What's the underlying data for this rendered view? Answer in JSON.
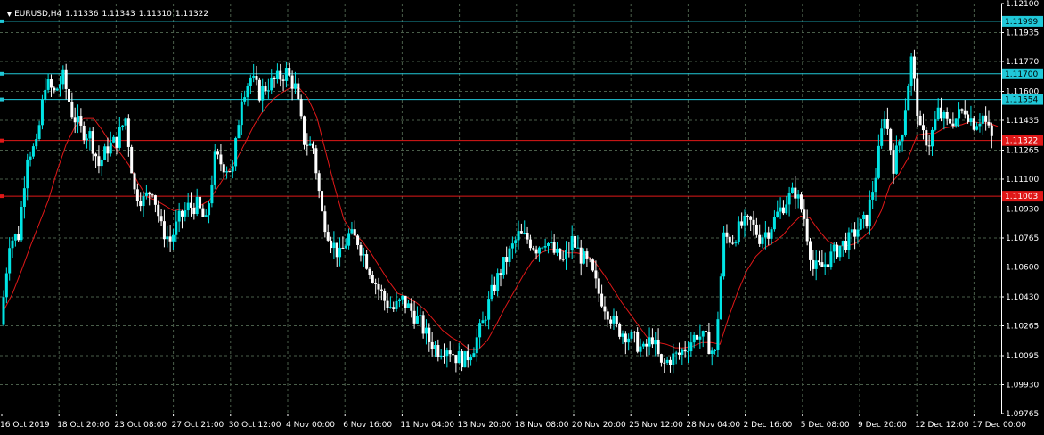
{
  "header": {
    "symbol": "EURUSD,H4",
    "open": "1.11336",
    "high": "1.11343",
    "low": "1.11310",
    "close": "1.11322"
  },
  "colors": {
    "background": "#000000",
    "grid": "#4a5e4a",
    "axis": "#ffffff",
    "bull_candle": "#00e5e5",
    "bear_candle": "#ffffff",
    "ma_line": "#e01818",
    "level_cyan": "#20c8d8",
    "level_red": "#e01818"
  },
  "chart_data": {
    "type": "candlestick",
    "title": "EURUSD,H4",
    "xlabel": "",
    "ylabel": "",
    "ylim": [
      1.09765,
      1.121
    ],
    "grid": true,
    "y_ticks": [
      "1.12100",
      "1.11935",
      "1.11770",
      "1.11600",
      "1.11435",
      "1.11265",
      "1.11100",
      "1.10930",
      "1.10765",
      "1.10600",
      "1.10430",
      "1.10265",
      "1.10095",
      "1.09930",
      "1.09765"
    ],
    "x_ticks": [
      "16 Oct 2019",
      "18 Oct 20:00",
      "23 Oct 08:00",
      "27 Oct 21:00",
      "30 Oct 12:00",
      "4 Nov 00:00",
      "6 Nov 16:00",
      "11 Nov 04:00",
      "13 Nov 20:00",
      "18 Nov 08:00",
      "20 Nov 20:00",
      "25 Nov 12:00",
      "28 Nov 04:00",
      "2 Dec 16:00",
      "5 Dec 08:00",
      "9 Dec 20:00",
      "12 Dec 12:00",
      "17 Dec 00:00"
    ],
    "close_series": [
      1.1027,
      1.1075,
      1.1078,
      1.1125,
      1.1128,
      1.1165,
      1.1159,
      1.1168,
      1.1148,
      1.1138,
      1.1135,
      1.1118,
      1.1128,
      1.1132,
      1.1145,
      1.1103,
      1.1098,
      1.1105,
      1.1082,
      1.1075,
      1.1087,
      1.1094,
      1.1095,
      1.1085,
      1.1122,
      1.1118,
      1.1115,
      1.1158,
      1.1168,
      1.1159,
      1.1164,
      1.1167,
      1.1171,
      1.1162,
      1.1132,
      1.1128,
      1.109,
      1.1075,
      1.1066,
      1.1078,
      1.1075,
      1.1063,
      1.1051,
      1.1041,
      1.1036,
      1.1041,
      1.1035,
      1.1028,
      1.1018,
      1.1013,
      1.1015,
      1.1009,
      1.1007,
      1.1015,
      1.1028,
      1.1045,
      1.1058,
      1.1068,
      1.1078,
      1.1076,
      1.1071,
      1.1076,
      1.1068,
      1.1063,
      1.1075,
      1.1066,
      1.106,
      1.1045,
      1.1035,
      1.1025,
      1.1022,
      1.1018,
      1.1012,
      1.102,
      1.1003,
      1.1008,
      1.101,
      1.1016,
      1.1022,
      1.1018,
      1.101,
      1.1077,
      1.1076,
      1.1084,
      1.1085,
      1.1077,
      1.1081,
      1.109,
      1.1098,
      1.1103,
      1.1088,
      1.1059,
      1.106,
      1.1066,
      1.1072,
      1.1075,
      1.1082,
      1.1087,
      1.1113,
      1.1148,
      1.1118,
      1.1139,
      1.1178,
      1.1136,
      1.1131,
      1.1148,
      1.1142,
      1.1145,
      1.115,
      1.1142,
      1.1146,
      1.1133
    ],
    "ma_series": [
      1.1035,
      1.1045,
      1.1058,
      1.1072,
      1.1085,
      1.1098,
      1.1115,
      1.113,
      1.114,
      1.1145,
      1.1145,
      1.1138,
      1.113,
      1.1125,
      1.1118,
      1.1108,
      1.11,
      1.1098,
      1.1095,
      1.1092,
      1.1093,
      1.1093,
      1.1095,
      1.1098,
      1.1106,
      1.1114,
      1.1121,
      1.1131,
      1.1141,
      1.1149,
      1.1155,
      1.1159,
      1.1162,
      1.1162,
      1.1156,
      1.1145,
      1.1125,
      1.1105,
      1.1087,
      1.1079,
      1.1075,
      1.1068,
      1.106,
      1.1052,
      1.1045,
      1.1043,
      1.104,
      1.1036,
      1.103,
      1.1024,
      1.102,
      1.1017,
      1.1013,
      1.1013,
      1.1018,
      1.1027,
      1.1037,
      1.1046,
      1.1055,
      1.1063,
      1.1068,
      1.107,
      1.107,
      1.1068,
      1.1068,
      1.1067,
      1.1063,
      1.1056,
      1.1048,
      1.104,
      1.1033,
      1.1026,
      1.1019,
      1.1017,
      1.1016,
      1.1014,
      1.1014,
      1.1015,
      1.1017,
      1.1017,
      1.1016,
      1.1032,
      1.1046,
      1.1058,
      1.1066,
      1.1071,
      1.1074,
      1.1078,
      1.1084,
      1.1089,
      1.1088,
      1.1081,
      1.1075,
      1.1072,
      1.1072,
      1.1073,
      1.1077,
      1.1082,
      1.1092,
      1.1107,
      1.1113,
      1.1122,
      1.1135,
      1.1136,
      1.1136,
      1.1139,
      1.114,
      1.1141,
      1.1143,
      1.1142,
      1.1142,
      1.114
    ],
    "horizontal_levels": [
      {
        "price": 1.11999,
        "label": "1.11999",
        "color": "cyan"
      },
      {
        "price": 1.117,
        "label": "1.11700",
        "color": "cyan"
      },
      {
        "price": 1.11554,
        "label": "1.11554",
        "color": "cyan"
      },
      {
        "price": 1.1132,
        "label": "1.11322",
        "color": "red"
      },
      {
        "price": 1.11003,
        "label": "1.11003",
        "color": "red"
      }
    ]
  }
}
